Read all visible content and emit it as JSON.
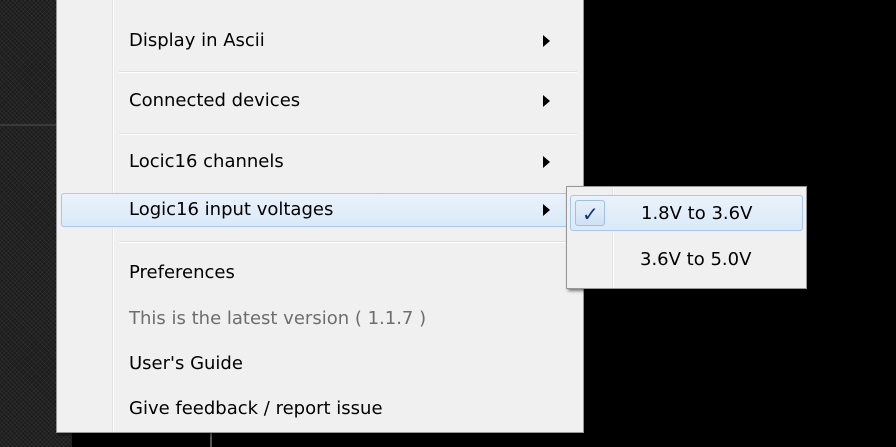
{
  "menu": {
    "items": [
      {
        "label": "Display in Ascii",
        "has_submenu": true
      },
      {
        "label": "Connected devices",
        "has_submenu": true
      },
      {
        "label": "Locic16 channels",
        "has_submenu": true
      },
      {
        "label": "Logic16 input voltages",
        "has_submenu": true
      },
      {
        "label": "Preferences"
      },
      {
        "label": "This is the latest version ( 1.1.7 )"
      },
      {
        "label": "User's Guide"
      },
      {
        "label": "Give feedback / report issue"
      }
    ]
  },
  "submenu": {
    "items": [
      {
        "label": "1.8V to 3.6V",
        "checked": true,
        "check_glyph": "✓"
      },
      {
        "label": "3.6V to 5.0V",
        "checked": false
      }
    ]
  }
}
